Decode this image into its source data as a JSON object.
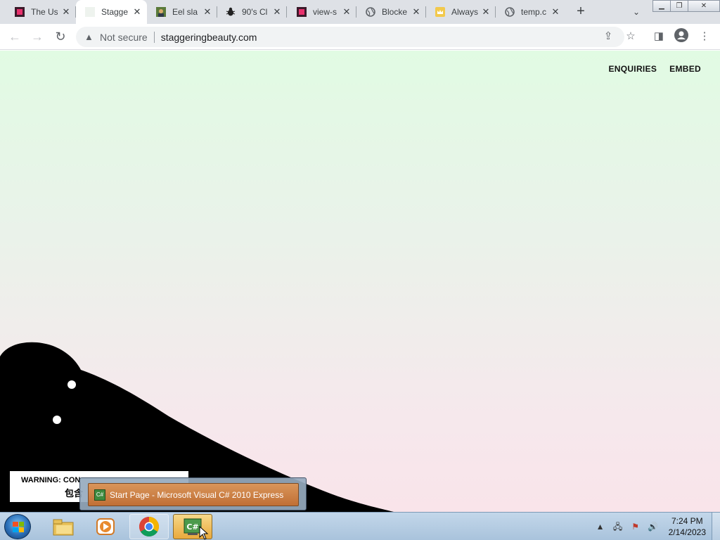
{
  "tabs": [
    {
      "title": "The Us",
      "favicon": "pink-square-icon",
      "active": false
    },
    {
      "title": "Stagge",
      "favicon": "blank-page-icon",
      "active": true
    },
    {
      "title": "Eel sla",
      "favicon": "portrait-icon",
      "active": false
    },
    {
      "title": "90's Cl",
      "favicon": "bug-icon",
      "active": false
    },
    {
      "title": "view-s",
      "favicon": "pink-square-icon",
      "active": false
    },
    {
      "title": "Blocke",
      "favicon": "globe-icon",
      "active": false
    },
    {
      "title": "Always",
      "favicon": "crown-icon",
      "active": false
    },
    {
      "title": "temp.c",
      "favicon": "globe-icon",
      "active": false
    }
  ],
  "toolbar": {
    "security_label": "Not secure",
    "url": "staggeringbeauty.com"
  },
  "page": {
    "links": [
      "ENQUIRIES",
      "EMBED"
    ],
    "warning_line1": "WARNING: CON",
    "warning_line2": "包含"
  },
  "taskbar_popup": {
    "window_title": "Start Page - Microsoft Visual C# 2010 Express"
  },
  "taskbar": {
    "apps": [
      "windows-explorer",
      "windows-media-player",
      "google-chrome",
      "visual-csharp-2010-express"
    ],
    "time": "7:24 PM",
    "date": "2/14/2023"
  },
  "colors": {
    "page_top": "#e1fbe3",
    "page_bottom": "#f9e4ea",
    "creature": "#000000",
    "taskbar_active": "#e9a93c"
  }
}
